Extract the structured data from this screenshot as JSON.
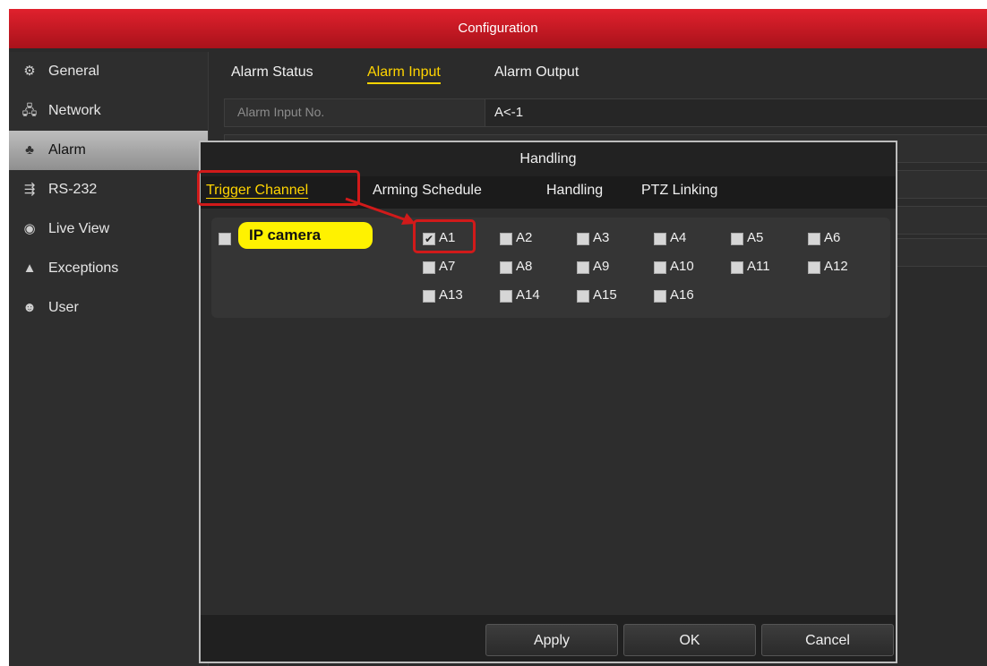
{
  "window": {
    "title": "Configuration"
  },
  "sidebar": {
    "items": [
      {
        "label": "General",
        "icon": "gear-icon",
        "glyph": "⚙",
        "active": false
      },
      {
        "label": "Network",
        "icon": "network-icon",
        "glyph": "🖧",
        "active": false
      },
      {
        "label": "Alarm",
        "icon": "alarm-icon",
        "glyph": "♣",
        "active": true
      },
      {
        "label": "RS-232",
        "icon": "rs232-icon",
        "glyph": "⇶",
        "active": false
      },
      {
        "label": "Live View",
        "icon": "eye-icon",
        "glyph": "◉",
        "active": false
      },
      {
        "label": "Exceptions",
        "icon": "warning-icon",
        "glyph": "▲",
        "active": false
      },
      {
        "label": "User",
        "icon": "users-icon",
        "glyph": "☻",
        "active": false
      }
    ]
  },
  "config": {
    "tabs": [
      "Alarm Status",
      "Alarm Input",
      "Alarm Output"
    ],
    "active_tab": "Alarm Input",
    "alarm_input_no": {
      "label": "Alarm Input No.",
      "value": "A<-1"
    }
  },
  "dialog": {
    "title": "Handling",
    "tabs": [
      "Trigger Channel",
      "Arming Schedule",
      "Handling",
      "PTZ Linking"
    ],
    "active_tab": "Trigger Channel",
    "callout": "IP camera",
    "channels": [
      {
        "label": "A1",
        "checked": true
      },
      {
        "label": "A2",
        "checked": false
      },
      {
        "label": "A3",
        "checked": false
      },
      {
        "label": "A4",
        "checked": false
      },
      {
        "label": "A5",
        "checked": false
      },
      {
        "label": "A6",
        "checked": false
      },
      {
        "label": "A7",
        "checked": false
      },
      {
        "label": "A8",
        "checked": false
      },
      {
        "label": "A9",
        "checked": false
      },
      {
        "label": "A10",
        "checked": false
      },
      {
        "label": "A11",
        "checked": false
      },
      {
        "label": "A12",
        "checked": false
      },
      {
        "label": "A13",
        "checked": false
      },
      {
        "label": "A14",
        "checked": false
      },
      {
        "label": "A15",
        "checked": false
      },
      {
        "label": "A16",
        "checked": false
      }
    ],
    "buttons": {
      "apply": "Apply",
      "ok": "OK",
      "cancel": "Cancel"
    }
  },
  "colors": {
    "accent": "#ffd400",
    "title_red": "#c8161f",
    "highlight": "#d11a1a",
    "callout": "#fff200"
  }
}
